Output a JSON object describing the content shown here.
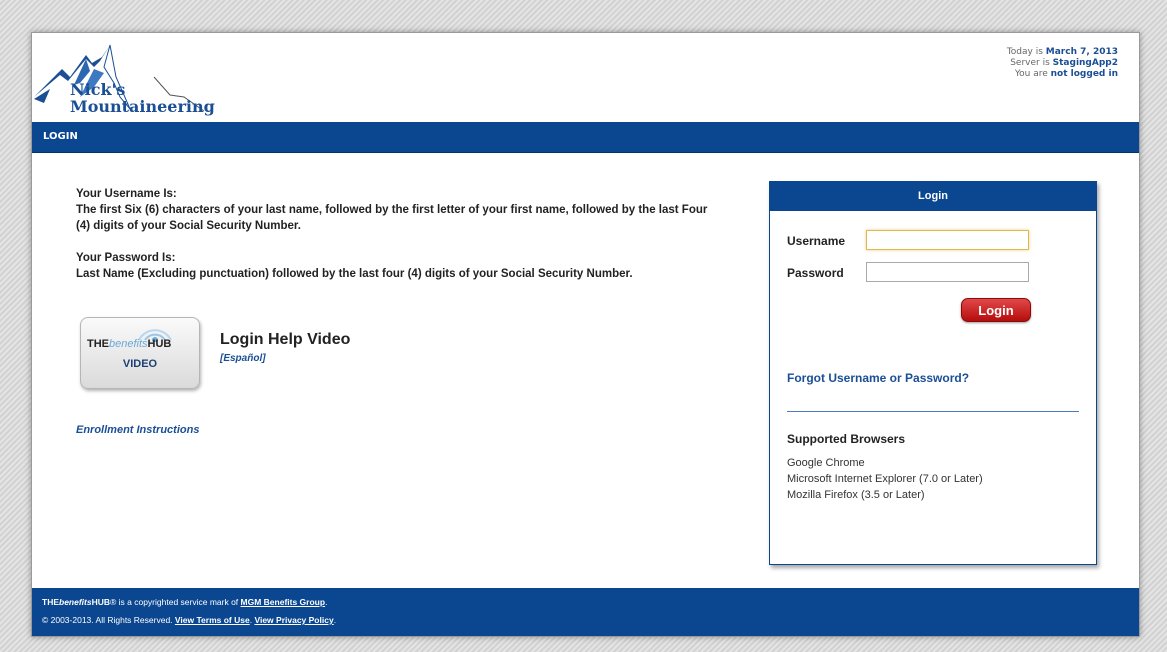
{
  "header": {
    "logo": {
      "line1": "Nick's",
      "line2": "Mountaineering"
    },
    "status": {
      "date_prefix": "Today is ",
      "date": "March 7, 2013",
      "server_prefix": "Server is ",
      "server": "StagingApp2",
      "login_prefix": "You are ",
      "login_state": "not logged in"
    }
  },
  "nav": {
    "title": "LOGIN"
  },
  "instructions": {
    "username_heading": "Your Username Is:",
    "username_text": "The first Six (6) characters of your last name, followed by the first letter of your first name, followed by the last Four (4) digits of your Social Security Number.",
    "password_heading": "Your Password Is:",
    "password_text": "Last Name (Excluding punctuation) followed by the last four (4) digits of your Social Security Number."
  },
  "video": {
    "thumb_brand_a": "THE",
    "thumb_brand_b": "benefits",
    "thumb_brand_c": "HUB",
    "thumb_label": "VIDEO",
    "title": "Login Help Video",
    "link": "[Español]"
  },
  "enrollment_link": "Enrollment Instructions",
  "login": {
    "heading": "Login",
    "username_label": "Username",
    "username_value": "",
    "password_label": "Password",
    "password_value": "",
    "button": "Login",
    "forgot": "Forgot Username or Password?",
    "browsers_title": "Supported Browsers",
    "browsers": [
      "Google Chrome",
      "Microsoft Internet Explorer (7.0 or Later)",
      "Mozilla Firefox (3.5 or Later)"
    ]
  },
  "footer": {
    "line1_a": "THE",
    "line1_b": "benefits",
    "line1_c": "HUB",
    "line1_d": "® is a copyrighted service mark of ",
    "line1_link": "MGM Benefits Group",
    "line1_end": ".",
    "line2_a": "© 2003-2013.  All Rights Reserved.  ",
    "terms": "View Terms of Use",
    "line2_sep": ".  ",
    "privacy": "View Privacy Policy",
    "line2_end": "."
  },
  "colors": {
    "brand_blue": "#0b4690",
    "link_blue": "#1a4f95",
    "button_red": "#c41c1c"
  }
}
